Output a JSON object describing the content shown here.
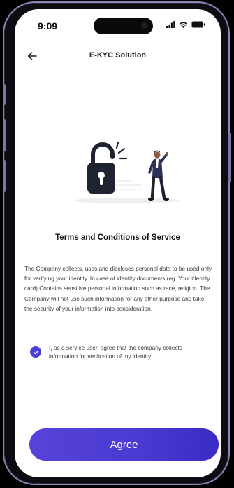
{
  "status": {
    "time": "9:09"
  },
  "header": {
    "title": "E-KYC Solution",
    "back_icon": "arrow-left-icon"
  },
  "content": {
    "heading": "Terms and Conditions of Service",
    "paragraph": "The Company collects, uses and discloses personal data to be used only for verifying your identity. In case of identity documents (eg. Your identity card) Contains sensitive personal information such as race, religion. The Company will not use such information for any other purpose and take the security of your information into consideration.",
    "consent_text": "I, as a service user, agree that the company collects information for verification of my identity.",
    "consent_checked": true
  },
  "actions": {
    "agree_label": "Agree"
  },
  "colors": {
    "accent": "#4b3fd8",
    "button_start": "#5743d9",
    "button_end": "#3a2bc6"
  }
}
